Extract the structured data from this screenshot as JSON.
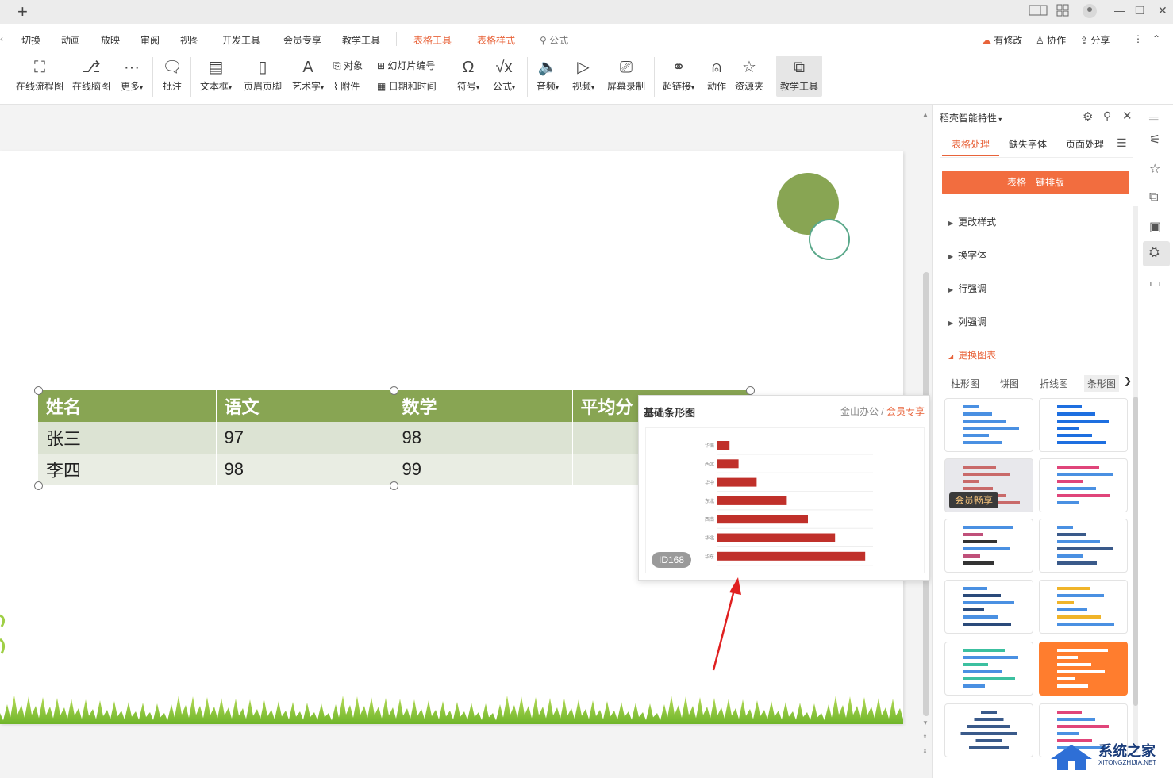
{
  "titlebar": {
    "new_tab": "+",
    "minimize": "—",
    "restore": "❐",
    "close": "✕"
  },
  "menu": {
    "tabs": [
      "切换",
      "动画",
      "放映",
      "审阅",
      "视图",
      "开发工具",
      "会员专享",
      "教学工具",
      "表格工具",
      "表格样式"
    ],
    "search": "公式",
    "right": {
      "modified": "有修改",
      "collab": "协作",
      "share": "分享"
    }
  },
  "ribbon": {
    "items": [
      "在线流程图",
      "在线脑图",
      "更多",
      "批注",
      "文本框",
      "页眉页脚",
      "艺术字",
      "符号",
      "公式",
      "音频",
      "视频",
      "屏幕录制",
      "超链接",
      "动作",
      "资源夹",
      "教学工具"
    ],
    "small": {
      "object": "对象",
      "slide_no": "幻灯片编号",
      "attach": "附件",
      "datetime": "日期和时间"
    }
  },
  "table": {
    "headers": [
      "姓名",
      "语文",
      "数学",
      "平均分"
    ],
    "rows": [
      [
        "张三",
        "97",
        "98",
        ""
      ],
      [
        "李四",
        "98",
        "99",
        ""
      ]
    ]
  },
  "popup": {
    "title": "基础条形图",
    "brand": "金山办公",
    "brand_sep": "/",
    "vip": "会员专享",
    "id_tag": "ID168",
    "chart_data": {
      "type": "bar",
      "orientation": "horizontal",
      "categories": [
        "华南",
        "西北",
        "华中",
        "东北",
        "西南",
        "华北",
        "华东"
      ],
      "values": [
        8,
        14,
        26,
        46,
        60,
        78,
        98
      ],
      "color": "#c0302a"
    }
  },
  "panel": {
    "title": "稻壳智能特性",
    "tabs": [
      "表格处理",
      "缺失字体",
      "页面处理"
    ],
    "onekey_button": "表格一键排版",
    "sections": [
      "更改样式",
      "换字体",
      "行强调",
      "列强调",
      "更换图表"
    ],
    "chart_tabs": [
      "柱形图",
      "饼图",
      "折线图",
      "条形图"
    ],
    "vip_badge": "会员畅享"
  },
  "watermark": {
    "title": "系统之家",
    "url": "XITONGZHIJIA.NET"
  },
  "colors": {
    "accent": "#e8633a",
    "table_header": "#88a553",
    "circle": "#88a553",
    "bar_red": "#c0302a",
    "orange_btn": "#f26d3f"
  }
}
